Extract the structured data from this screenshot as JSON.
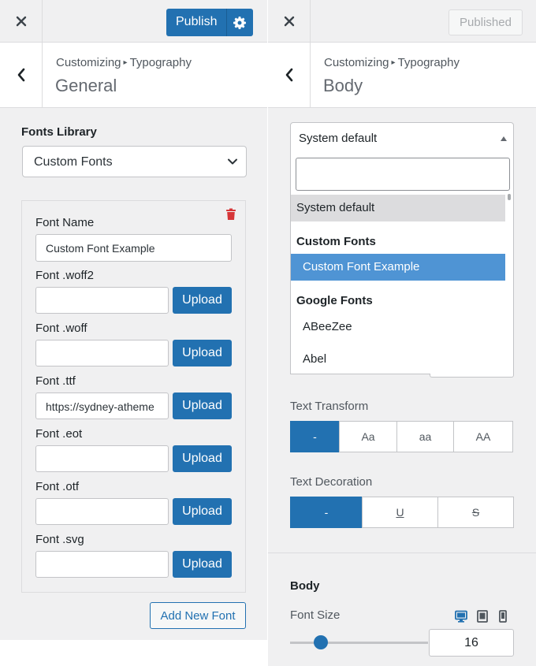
{
  "left": {
    "publish_label": "Publish",
    "breadcrumb_a": "Customizing",
    "breadcrumb_b": "Typography",
    "section_title": "General",
    "fonts_library_label": "Fonts Library",
    "fonts_library_value": "Custom Fonts",
    "font_name_label": "Font Name",
    "font_name_value": "Custom Font Example",
    "fields": [
      {
        "label": "Font .woff2",
        "value": ""
      },
      {
        "label": "Font .woff",
        "value": ""
      },
      {
        "label": "Font .ttf",
        "value": "https://sydney-atheme"
      },
      {
        "label": "Font .eot",
        "value": ""
      },
      {
        "label": "Font .otf",
        "value": ""
      },
      {
        "label": "Font .svg",
        "value": ""
      }
    ],
    "upload_label": "Upload",
    "add_new_font_label": "Add New Font"
  },
  "right": {
    "published_label": "Published",
    "breadcrumb_a": "Customizing",
    "breadcrumb_b": "Typography",
    "section_title": "Body",
    "font_select_value": "System default",
    "dropdown": {
      "search_value": "",
      "items": {
        "system_default": "System default",
        "group_custom": "Custom Fonts",
        "custom_example": "Custom Font Example",
        "group_google": "Google Fonts",
        "abeezee": "ABeeZee",
        "abel": "Abel"
      }
    },
    "text_transform_label": "Text Transform",
    "text_transform_options": [
      "-",
      "Aa",
      "aa",
      "AA"
    ],
    "text_decoration_label": "Text Decoration",
    "text_decoration_options": [
      "-",
      "U",
      "S"
    ],
    "body_heading": "Body",
    "font_size_label": "Font Size",
    "font_size_value": "16"
  },
  "colors": {
    "accent": "#2271b1",
    "danger": "#d63638",
    "highlight": "#4f94d4"
  }
}
